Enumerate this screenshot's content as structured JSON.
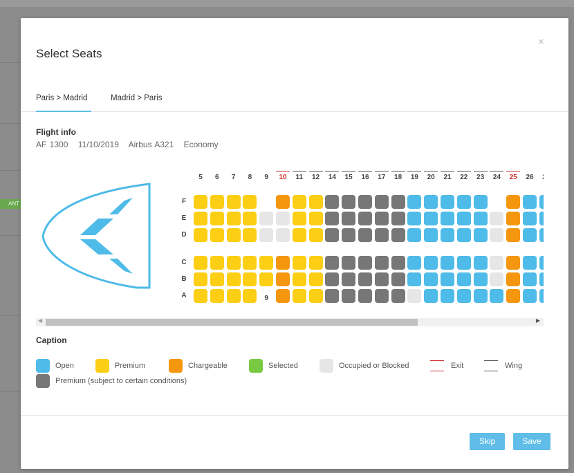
{
  "modal": {
    "title": "Select Seats",
    "close_label": "×"
  },
  "tabs": [
    {
      "label": "Paris > Madrid",
      "active": true
    },
    {
      "label": "Madrid > Paris",
      "active": false
    }
  ],
  "flight_info": {
    "heading": "Flight info",
    "flight_number": "AF 1300",
    "date": "11/10/2019",
    "aircraft": "Airbus A321",
    "cabin": "Economy"
  },
  "colors": {
    "open": "#4ebbe8",
    "premium": "#fcce14",
    "chargeable": "#f5960f",
    "selected": "#7ac943",
    "blocked": "#e6e6e6",
    "premium_conditional": "#777777",
    "exit": "#d03030",
    "wing": "#555555"
  },
  "seat_map": {
    "columns": [
      "5",
      "6",
      "7",
      "8",
      "9",
      "10",
      "11",
      "12",
      "14",
      "15",
      "16",
      "17",
      "18",
      "19",
      "20",
      "21",
      "22",
      "23",
      "24",
      "25",
      "26",
      "27",
      "2"
    ],
    "exit_columns": [
      "10",
      "25"
    ],
    "wing_columns": [
      "11",
      "12",
      "14",
      "15",
      "16",
      "17",
      "18",
      "19",
      "20",
      "21",
      "22",
      "23",
      "24"
    ],
    "rows": [
      {
        "letter": "F",
        "seats": [
          "P",
          "P",
          "P",
          "P",
          "N",
          "C",
          "P",
          "P",
          "G",
          "G",
          "G",
          "G",
          "G",
          "O",
          "O",
          "O",
          "O",
          "O",
          "N",
          "C",
          "O",
          "O",
          "O"
        ]
      },
      {
        "letter": "E",
        "seats": [
          "P",
          "P",
          "P",
          "P",
          "B",
          "B",
          "P",
          "P",
          "G",
          "G",
          "G",
          "G",
          "G",
          "O",
          "O",
          "O",
          "O",
          "O",
          "B",
          "C",
          "O",
          "O",
          "O"
        ]
      },
      {
        "letter": "D",
        "seats": [
          "P",
          "P",
          "P",
          "P",
          "B",
          "B",
          "P",
          "P",
          "G",
          "G",
          "G",
          "G",
          "G",
          "O",
          "O",
          "O",
          "O",
          "O",
          "B",
          "C",
          "O",
          "O",
          "O"
        ]
      },
      {
        "letter": "C",
        "seats": [
          "P",
          "P",
          "P",
          "P",
          "P",
          "C",
          "P",
          "P",
          "G",
          "G",
          "G",
          "G",
          "G",
          "O",
          "O",
          "O",
          "O",
          "O",
          "B",
          "C",
          "O",
          "O",
          "G"
        ]
      },
      {
        "letter": "B",
        "seats": [
          "P",
          "P",
          "P",
          "P",
          "P",
          "C",
          "P",
          "P",
          "G",
          "G",
          "G",
          "G",
          "G",
          "O",
          "O",
          "O",
          "O",
          "O",
          "B",
          "C",
          "O",
          "O",
          "G"
        ]
      },
      {
        "letter": "A",
        "seats": [
          "P",
          "P",
          "P",
          "P",
          "N",
          "C",
          "P",
          "P",
          "G",
          "G",
          "G",
          "G",
          "G",
          "B",
          "O",
          "O",
          "O",
          "O",
          "O",
          "C",
          "O",
          "O",
          "G"
        ]
      }
    ]
  },
  "caption": {
    "heading": "Caption",
    "items": [
      {
        "key": "open",
        "label": "Open",
        "icon": "open-seat-swatch"
      },
      {
        "key": "premium",
        "label": "Premium",
        "icon": "premium-seat-swatch"
      },
      {
        "key": "chargeable",
        "label": "Chargeable",
        "icon": "chargeable-seat-swatch"
      },
      {
        "key": "selected",
        "label": "Selected",
        "icon": "selected-seat-swatch"
      },
      {
        "key": "blocked",
        "label": "Occupied or Blocked",
        "icon": "blocked-seat-swatch"
      },
      {
        "key": "exit",
        "label": "Exit",
        "icon": "exit-lines-icon"
      },
      {
        "key": "wing",
        "label": "Wing",
        "icon": "wing-lines-icon"
      },
      {
        "key": "premium_conditional",
        "label": "Premium (subject to certain conditions)",
        "icon": "conditional-premium-swatch"
      }
    ]
  },
  "buttons": {
    "skip": "Skip",
    "save": "Save"
  },
  "background": {
    "badge": "ANT"
  }
}
